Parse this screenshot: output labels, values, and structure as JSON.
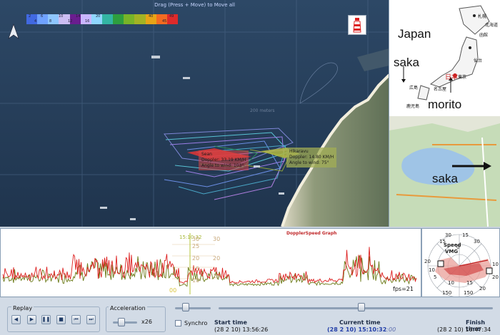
{
  "map": {
    "drag_hint": "Drag (Press + Move) to Move all",
    "distance_label": "200 meters",
    "legend": {
      "labels_top": [
        "2",
        "6",
        "10",
        "14",
        "20",
        "40",
        "49"
      ],
      "labels_bottom": [
        "4",
        "8",
        "12",
        "16",
        "45"
      ],
      "colors": [
        "#4169e1",
        "#6fa2ff",
        "#8ec6ff",
        "#cbbdf2",
        "#6a1d8f",
        "#c9b6ff",
        "#8fd6ff",
        "#33b5a3",
        "#2e9e3e",
        "#78b428",
        "#a3b324",
        "#e7a417",
        "#f36b21",
        "#de2a2a"
      ]
    },
    "boats": [
      {
        "name": "Sean",
        "speed_line": "Doppler: 33.19 KM/H",
        "angle_line": "Angle to wind: 103°"
      },
      {
        "name": "Hikaravu",
        "speed_line": "Doppler: 14.80 KM/H",
        "angle_line": "Angle to wind: 75°"
      }
    ]
  },
  "inset": {
    "country": "Japan",
    "city_top": "saka",
    "city_bottom": "saka",
    "right_label": "morito",
    "jp_labels": [
      "札幌",
      "函館",
      "仙台",
      "北海道",
      "日本",
      "東京",
      "広島",
      "名古屋",
      "鹿児島"
    ]
  },
  "graph": {
    "title": "DopplerSpeed Graph",
    "cursor_time": "15:10:32",
    "fps": "fps=21",
    "y_left": [
      "30",
      "25",
      "20",
      "15",
      "10"
    ],
    "y_left_zero": "00",
    "y_right": [
      "30",
      "20",
      "10"
    ],
    "colors": {
      "doppler": "#dd1f1f",
      "vmg": "#6b7a17",
      "cursor": "#b5c43a"
    }
  },
  "polar": {
    "speed_label": "Speed",
    "vmg_label": "VMG",
    "rings": [
      "30",
      "15",
      "0",
      "15",
      "30"
    ],
    "ticks": [
      "20",
      "10",
      "5",
      "10",
      "20",
      "10",
      "15",
      "20",
      "150",
      "150"
    ]
  },
  "controls": {
    "replay_label": "Replay",
    "acceleration_label": "Acceleration",
    "acceleration_value": "x26",
    "synchro_label": "Synchro",
    "start_time_label": "Start time",
    "start_time_value": "(28 2 10) 13:56:26",
    "current_time_label": "Current time",
    "current_time_value": "(28 2 10) 15:10:32",
    "current_time_suffix": ":00",
    "finish_time_label": "Finish time",
    "finish_time_value": "(28 2 10) 16:47:34",
    "timeline_progress": 0.52,
    "acceleration_level": 0.35,
    "zoom_level": 0.3
  }
}
